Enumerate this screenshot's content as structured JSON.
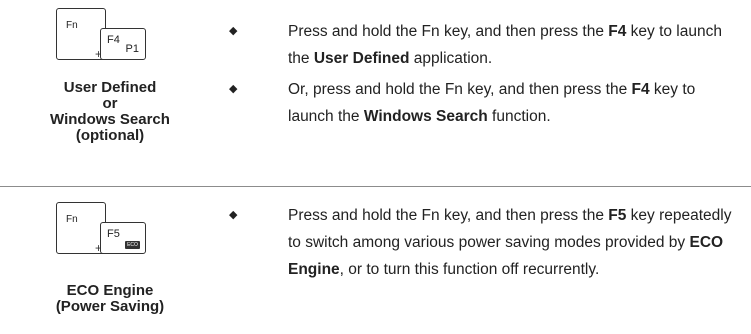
{
  "section1": {
    "keys": {
      "fn": "Fn",
      "f": "F4",
      "f_sub": "P1",
      "plus": "+"
    },
    "caption": [
      "User Defined",
      "or",
      "Windows Search",
      "(optional)"
    ],
    "bullets": [
      {
        "parts": [
          "Press and hold the Fn key, and then press the ",
          "F4",
          " key to launch the ",
          "User Defined",
          " application."
        ]
      },
      {
        "parts": [
          "Or, press and hold the Fn key, and then press the ",
          "F4",
          " key to launch the ",
          "Windows Search",
          " function."
        ]
      }
    ]
  },
  "section2": {
    "keys": {
      "fn": "Fn",
      "f": "F5",
      "f_badge": "ECO",
      "plus": "+"
    },
    "caption": [
      "ECO Engine",
      "(Power Saving)"
    ],
    "bullets": [
      {
        "parts": [
          "Press and hold the Fn key, and then press the ",
          "F5",
          " key repeatedly to switch among various power saving modes provided by ",
          "ECO Engine",
          ", or to turn this function off recurrently."
        ]
      }
    ]
  },
  "bullet_glyph": "◆"
}
